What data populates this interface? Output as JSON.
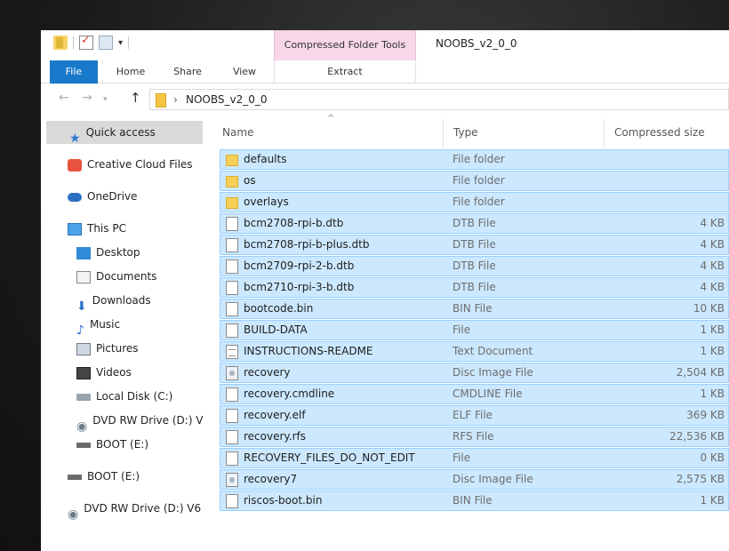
{
  "window": {
    "title": "NOOBS_v2_0_0",
    "context_tab_group": "Compressed Folder Tools"
  },
  "ribbon": {
    "tabs": [
      {
        "label": "File"
      },
      {
        "label": "Home"
      },
      {
        "label": "Share"
      },
      {
        "label": "View"
      },
      {
        "label": "Extract"
      }
    ]
  },
  "address": {
    "path": "NOOBS_v2_0_0"
  },
  "nav": {
    "items": [
      {
        "label": "Quick access",
        "icon": "star-icon"
      },
      {
        "label": "Creative Cloud Files",
        "icon": "creative-cloud-icon"
      },
      {
        "label": "OneDrive",
        "icon": "cloud-icon"
      },
      {
        "label": "This PC",
        "icon": "computer-icon"
      },
      {
        "label": "Desktop",
        "icon": "desktop-icon"
      },
      {
        "label": "Documents",
        "icon": "documents-icon"
      },
      {
        "label": "Downloads",
        "icon": "download-icon"
      },
      {
        "label": "Music",
        "icon": "music-icon"
      },
      {
        "label": "Pictures",
        "icon": "pictures-icon"
      },
      {
        "label": "Videos",
        "icon": "videos-icon"
      },
      {
        "label": "Local Disk (C:)",
        "icon": "disk-icon"
      },
      {
        "label": "DVD RW Drive (D:) V",
        "icon": "dvd-icon"
      },
      {
        "label": "BOOT (E:)",
        "icon": "usb-drive-icon"
      },
      {
        "label": "BOOT (E:)",
        "icon": "usb-drive-icon"
      },
      {
        "label": "DVD RW Drive (D:) V6",
        "icon": "dvd-icon"
      }
    ]
  },
  "columns": {
    "name": "Name",
    "type": "Type",
    "size": "Compressed size"
  },
  "files": [
    {
      "name": "defaults",
      "type": "File folder",
      "size": "",
      "icon": "folder-icon"
    },
    {
      "name": "os",
      "type": "File folder",
      "size": "",
      "icon": "folder-icon"
    },
    {
      "name": "overlays",
      "type": "File folder",
      "size": "",
      "icon": "folder-icon"
    },
    {
      "name": "bcm2708-rpi-b.dtb",
      "type": "DTB File",
      "size": "4 KB",
      "icon": "file-icon"
    },
    {
      "name": "bcm2708-rpi-b-plus.dtb",
      "type": "DTB File",
      "size": "4 KB",
      "icon": "file-icon"
    },
    {
      "name": "bcm2709-rpi-2-b.dtb",
      "type": "DTB File",
      "size": "4 KB",
      "icon": "file-icon"
    },
    {
      "name": "bcm2710-rpi-3-b.dtb",
      "type": "DTB File",
      "size": "4 KB",
      "icon": "file-icon"
    },
    {
      "name": "bootcode.bin",
      "type": "BIN File",
      "size": "10 KB",
      "icon": "file-icon"
    },
    {
      "name": "BUILD-DATA",
      "type": "File",
      "size": "1 KB",
      "icon": "file-icon"
    },
    {
      "name": "INSTRUCTIONS-README",
      "type": "Text Document",
      "size": "1 KB",
      "icon": "text-document-icon"
    },
    {
      "name": "recovery",
      "type": "Disc Image File",
      "size": "2,504 KB",
      "icon": "disc-image-icon"
    },
    {
      "name": "recovery.cmdline",
      "type": "CMDLINE File",
      "size": "1 KB",
      "icon": "file-icon"
    },
    {
      "name": "recovery.elf",
      "type": "ELF File",
      "size": "369 KB",
      "icon": "file-icon"
    },
    {
      "name": "recovery.rfs",
      "type": "RFS File",
      "size": "22,536 KB",
      "icon": "file-icon"
    },
    {
      "name": "RECOVERY_FILES_DO_NOT_EDIT",
      "type": "File",
      "size": "0 KB",
      "icon": "file-icon"
    },
    {
      "name": "recovery7",
      "type": "Disc Image File",
      "size": "2,575 KB",
      "icon": "disc-image-icon"
    },
    {
      "name": "riscos-boot.bin",
      "type": "BIN File",
      "size": "1 KB",
      "icon": "file-icon"
    }
  ],
  "colors": {
    "selection_fill": "#cce8ff",
    "selection_border": "#99d1ff",
    "file_tab": "#1979ca",
    "context_tab": "#f7d7e8"
  }
}
